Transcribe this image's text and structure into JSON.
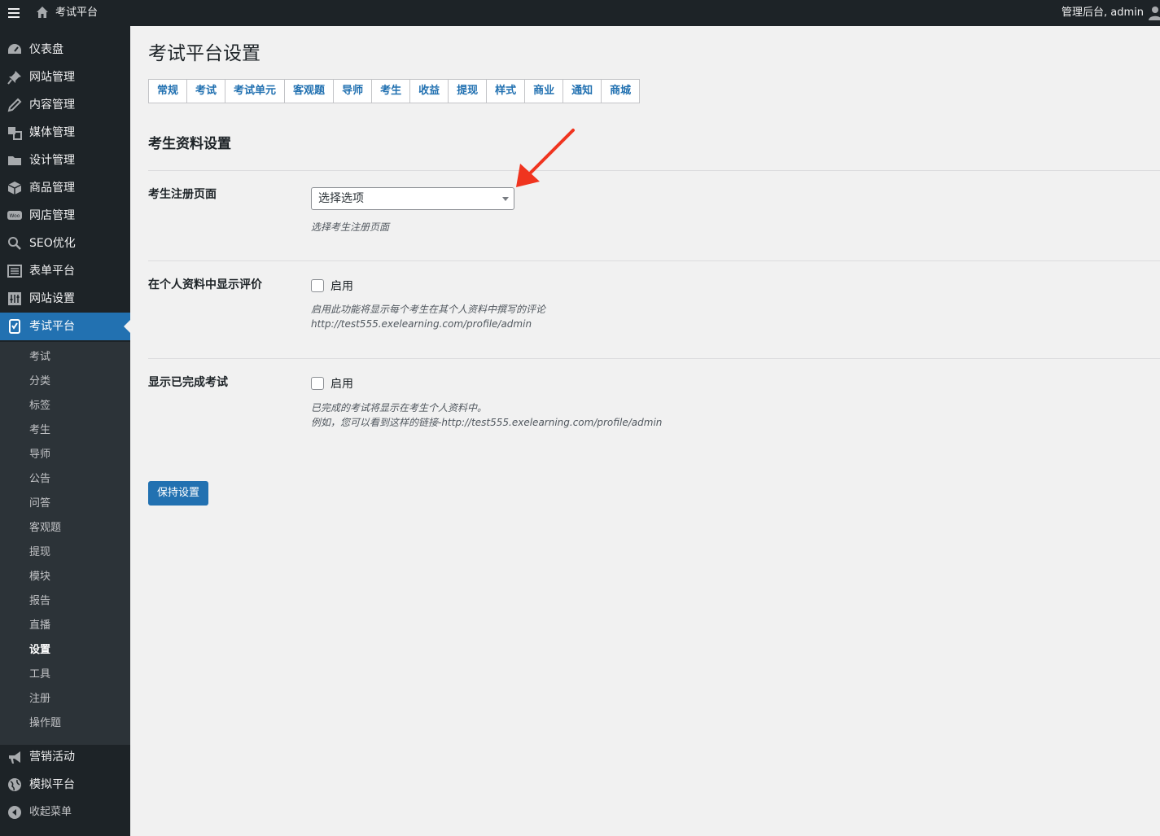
{
  "topbar": {
    "site_name": "考试平台",
    "account": "管理后台, admin"
  },
  "sidebar": {
    "items": [
      {
        "label": "仪表盘",
        "icon": "dashboard-icon"
      },
      {
        "label": "网站管理",
        "icon": "pin-icon"
      },
      {
        "label": "内容管理",
        "icon": "pencil-icon"
      },
      {
        "label": "媒体管理",
        "icon": "media-icon"
      },
      {
        "label": "设计管理",
        "icon": "folder-icon"
      },
      {
        "label": "商品管理",
        "icon": "box-icon"
      },
      {
        "label": "网店管理",
        "icon": "woo-icon"
      },
      {
        "label": "SEO优化",
        "icon": "search-icon"
      },
      {
        "label": "表单平台",
        "icon": "form-icon"
      },
      {
        "label": "网站设置",
        "icon": "settings-icon"
      },
      {
        "label": "考试平台",
        "icon": "exam-icon",
        "active": true
      }
    ],
    "submenu": [
      "考试",
      "分类",
      "标签",
      "考生",
      "导师",
      "公告",
      "问答",
      "客观题",
      "提现",
      "模块",
      "报告",
      "直播",
      "设置",
      "工具",
      "注册",
      "操作题"
    ],
    "submenu_current": "设置",
    "bottom_items": [
      {
        "label": "营销活动",
        "icon": "megaphone-icon"
      },
      {
        "label": "模拟平台",
        "icon": "globe-icon"
      }
    ],
    "collapse_label": "收起菜单"
  },
  "main": {
    "page_title": "考试平台设置",
    "tabs": [
      "常规",
      "考试",
      "考试单元",
      "客观题",
      "导师",
      "考生",
      "收益",
      "提现",
      "样式",
      "商业",
      "通知",
      "商城"
    ],
    "section_title": "考生资料设置",
    "registration": {
      "label": "考生注册页面",
      "select_value": "选择选项",
      "description": "选择考生注册页面"
    },
    "show_reviews": {
      "label": "在个人资料中显示评价",
      "checkbox_label": "启用",
      "description_line1": "启用此功能将显示每个考生在其个人资料中撰写的评论",
      "description_line2": "http://test555.exelearning.com/profile/admin"
    },
    "show_completed": {
      "label": "显示已完成考试",
      "checkbox_label": "启用",
      "description_line1": "已完成的考试将显示在考生个人资料中。",
      "description_line2": "例如，您可以看到这样的链接-http://test555.exelearning.com/profile/admin"
    },
    "save_label": "保持设置"
  },
  "colors": {
    "admin_bar": "#1d2327",
    "accent": "#2271b1",
    "submenu_bg": "#2c3338",
    "arrow": "#f0341f"
  }
}
